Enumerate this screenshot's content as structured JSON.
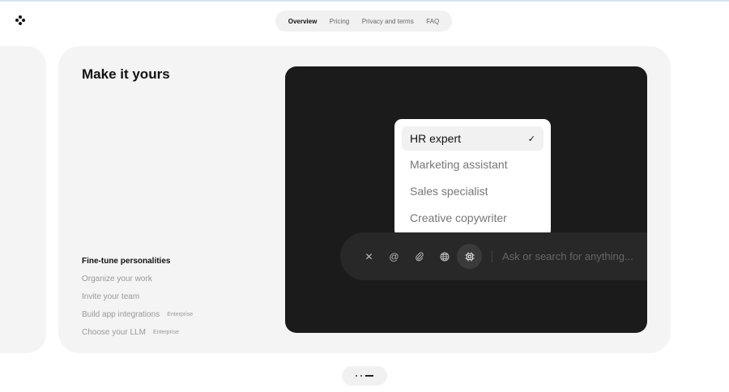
{
  "nav": {
    "items": [
      "Overview",
      "Pricing",
      "Privacy and terms",
      "FAQ"
    ],
    "active": "Overview"
  },
  "card": {
    "title": "Make it yours",
    "features": [
      {
        "label": "Fine-tune personalities",
        "badge": null
      },
      {
        "label": "Organize your work",
        "badge": null
      },
      {
        "label": "Invite your team",
        "badge": null
      },
      {
        "label": "Build app integrations",
        "badge": "Enterprise"
      },
      {
        "label": "Choose your LLM",
        "badge": "Enterprise"
      }
    ]
  },
  "dropdown": {
    "items": [
      "HR expert",
      "Marketing assistant",
      "Sales specialist",
      "Creative copywriter"
    ],
    "selected": "HR expert",
    "check": "✓"
  },
  "input": {
    "placeholder": "Ask or search for anything..."
  },
  "pager": {
    "pages": 3,
    "active": 3
  }
}
